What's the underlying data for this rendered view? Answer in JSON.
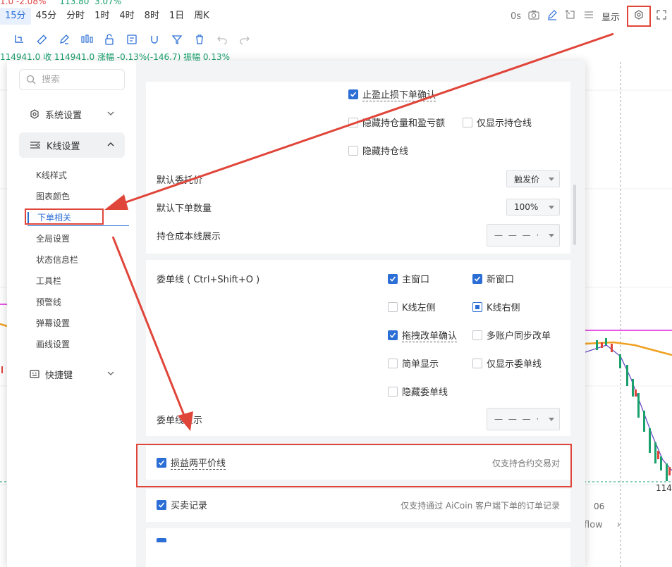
{
  "timeframes": [
    {
      "label": "15分",
      "active": true
    },
    {
      "label": "45分"
    },
    {
      "label": "分时"
    },
    {
      "label": "1时"
    },
    {
      "label": "4时"
    },
    {
      "label": "8时"
    },
    {
      "label": "1日"
    },
    {
      "label": "周K"
    }
  ],
  "top_right": {
    "countdown": "0s",
    "display_label": "显示"
  },
  "info_strip": "114941.0  收 114941.0  涨幅 -0.13%(-146.7)  振幅 0.13%",
  "chart_bottom": {
    "flow": "flow",
    "date_tag": "06",
    "price_tag": "114"
  },
  "sidebar": {
    "search_placeholder": "搜索",
    "system_settings": "系统设置",
    "kline_settings": "K线设置",
    "sub_items": [
      "K线样式",
      "图表颜色",
      "下单相关",
      "全局设置",
      "状态信息栏",
      "工具栏",
      "预警线",
      "弹幕设置",
      "画线设置"
    ],
    "shortcuts": "快捷键"
  },
  "section1": {
    "tp_sl_confirm": "止盈止损下单确认",
    "hide_position_pnl": "隐藏持仓量和盈亏额",
    "show_position_only": "仅显示持仓线",
    "hide_position_line": "隐藏持仓线",
    "default_order_price_label": "默认委托价",
    "default_order_price_value": "触发价",
    "default_order_qty_label": "默认下单数量",
    "default_order_qty_value": "100%",
    "position_cost_line_label": "持仓成本线展示",
    "position_cost_line_value": "— — — ·"
  },
  "section2": {
    "order_line_label": "委单线 ( Ctrl+Shift+O )",
    "main_window": "主窗口",
    "new_window": "新窗口",
    "kline_left": "K线左侧",
    "kline_right": "K线右侧",
    "drag_modify_confirm": "拖拽改单确认",
    "multi_account_sync": "多账户同步改单",
    "simple_display": "简单显示",
    "show_order_line_only": "仅显示委单线",
    "hide_order_line": "隐藏委单线",
    "order_line_display_label": "委单线显示",
    "order_line_display_value": "— — — ·"
  },
  "section3": {
    "pnl_flat_line": "损益两平价线",
    "pnl_flat_hint": "仅支持合约交易对"
  },
  "section4": {
    "trade_records": "买卖记录",
    "trade_records_hint": "仅支持通过 AiCoin 客户端下单的订单记录"
  },
  "colors": {
    "accent": "#2b6fd6",
    "annotation_red": "#e0453a"
  }
}
